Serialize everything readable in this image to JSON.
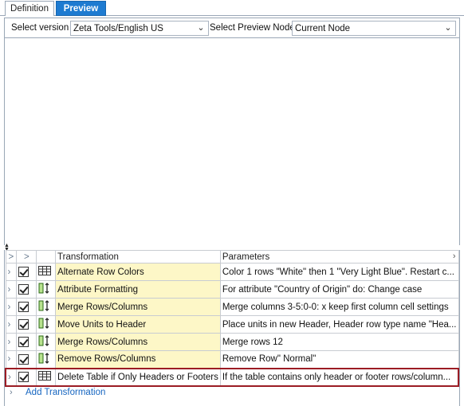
{
  "tabs": [
    {
      "label": "Definition"
    },
    {
      "label": "Preview"
    }
  ],
  "toolbar": {
    "version_label": "Select version",
    "version_value": "Zeta Tools/English US",
    "node_label": "Select Preview Node",
    "node_value": "Current Node"
  },
  "grid": {
    "headers": {
      "expand": ">",
      "check": ">",
      "transformation": "Transformation",
      "parameters": "Parameters"
    },
    "rows": [
      {
        "name": "Alternate Row Colors",
        "params": "Color 1 rows \"White\" then 1 \"Very Light Blue\".  Restart c...",
        "icon": "table-grid-icon",
        "checked": true,
        "selected": false
      },
      {
        "name": "Attribute Formatting",
        "params": "For attribute \"Country of Origin\" do: Change case",
        "icon": "column-resize-icon",
        "checked": true,
        "selected": false
      },
      {
        "name": "Merge Rows/Columns",
        "params": "Merge columns 3-5:0-0: x  keep first column cell settings",
        "icon": "column-resize-icon",
        "checked": true,
        "selected": false
      },
      {
        "name": "Move Units to Header",
        "params": "Place units in new Header, Header row type name \"Hea...",
        "icon": "column-resize-icon",
        "checked": true,
        "selected": false
      },
      {
        "name": "Merge Rows/Columns",
        "params": "Merge rows 12",
        "icon": "column-resize-icon",
        "checked": true,
        "selected": false
      },
      {
        "name": "Remove Rows/Columns",
        "params": "Remove Row\" Normal\"",
        "icon": "column-resize-icon",
        "checked": true,
        "selected": false
      },
      {
        "name": "Delete Table if Only Headers or Footers",
        "params": "If the table contains only header or footer rows/column...",
        "icon": "table-grid-icon",
        "checked": true,
        "selected": true
      }
    ],
    "add_label": "Add Transformation"
  },
  "colors": {
    "accent": "#1e7bd1",
    "name_cell_bg": "#fdf7c7",
    "selection_border": "#9b1c24",
    "link": "#1565c0"
  }
}
